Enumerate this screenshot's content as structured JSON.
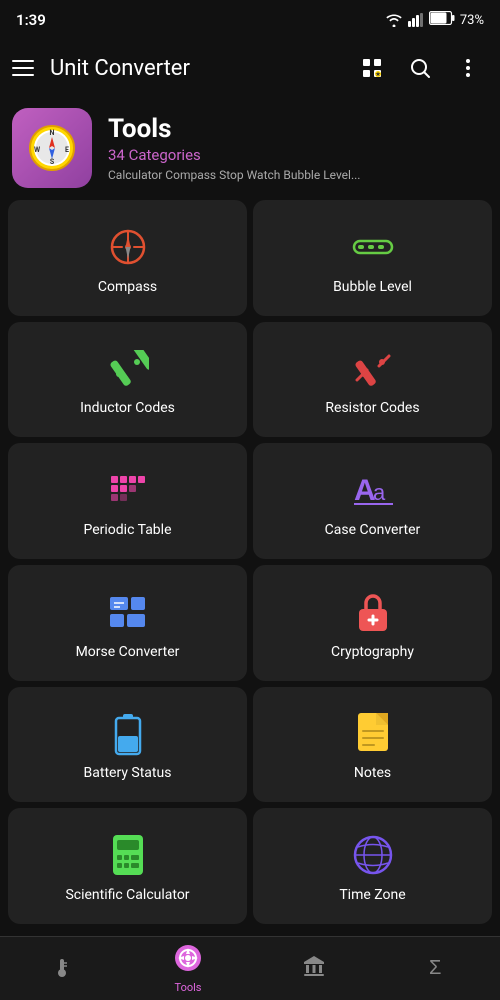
{
  "statusBar": {
    "time": "1:39",
    "battery": "73%"
  },
  "appBar": {
    "title": "Unit Converter",
    "menuIcon": "menu-icon",
    "featuredIcon": "featured-icon",
    "searchIcon": "search-icon",
    "moreIcon": "more-icon"
  },
  "header": {
    "title": "Tools",
    "categories": "34 Categories",
    "description": "Calculator Compass Stop Watch Bubble Level..."
  },
  "tools": [
    {
      "id": "compass",
      "label": "Compass",
      "iconClass": "icon-compass"
    },
    {
      "id": "bubble-level",
      "label": "Bubble Level",
      "iconClass": "icon-bubble"
    },
    {
      "id": "inductor-codes",
      "label": "Inductor Codes",
      "iconClass": "icon-inductor"
    },
    {
      "id": "resistor-codes",
      "label": "Resistor Codes",
      "iconClass": "icon-resistor"
    },
    {
      "id": "periodic-table",
      "label": "Periodic Table",
      "iconClass": "icon-periodic"
    },
    {
      "id": "case-converter",
      "label": "Case Converter",
      "iconClass": "icon-case"
    },
    {
      "id": "morse-converter",
      "label": "Morse Converter",
      "iconClass": "icon-morse"
    },
    {
      "id": "cryptography",
      "label": "Cryptography",
      "iconClass": "icon-crypto"
    },
    {
      "id": "battery-status",
      "label": "Battery Status",
      "iconClass": "icon-battery"
    },
    {
      "id": "notes",
      "label": "Notes",
      "iconClass": "icon-notes"
    },
    {
      "id": "scientific-calculator",
      "label": "Scientific Calculator",
      "iconClass": "icon-calculator"
    },
    {
      "id": "time-zone",
      "label": "Time Zone",
      "iconClass": "icon-timezone"
    }
  ],
  "bottomNav": [
    {
      "id": "thermometer",
      "label": "",
      "active": false
    },
    {
      "id": "tools",
      "label": "Tools",
      "active": true
    },
    {
      "id": "bank",
      "label": "",
      "active": false
    },
    {
      "id": "sigma",
      "label": "",
      "active": false
    }
  ],
  "icons": {
    "compass": "🧭",
    "bubble": "▬▬▬",
    "inductor": "⟋",
    "resistor": "⟋",
    "periodic": "▦",
    "case": "Aa",
    "morse": "▦",
    "crypto": "🔒",
    "battery": "🔋",
    "notes": "📄",
    "calculator": "🖩",
    "timezone": "🌐"
  }
}
